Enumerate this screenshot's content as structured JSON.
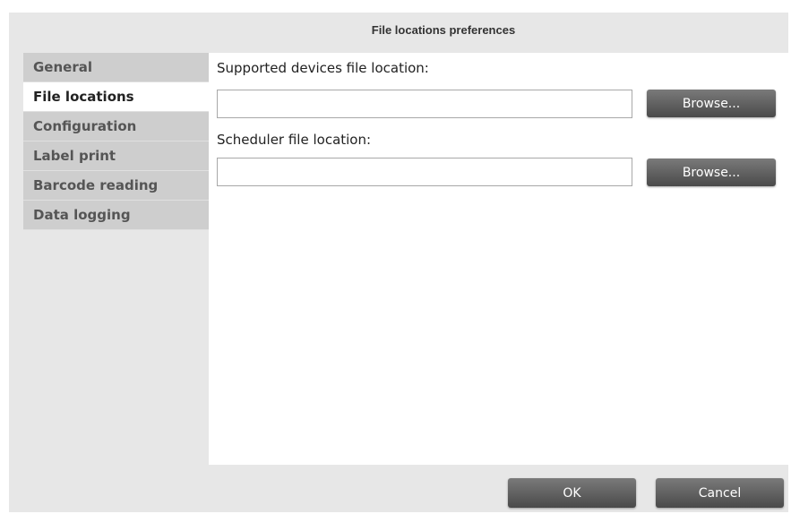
{
  "dialog": {
    "title": "File locations preferences"
  },
  "sidebar": {
    "items": [
      {
        "label": "General",
        "active": false
      },
      {
        "label": "File locations",
        "active": true
      },
      {
        "label": "Configuration",
        "active": false
      },
      {
        "label": "Label print",
        "active": false
      },
      {
        "label": "Barcode reading",
        "active": false
      },
      {
        "label": "Data logging",
        "active": false
      }
    ]
  },
  "content": {
    "supported_devices": {
      "label": "Supported devices file location:",
      "value": "",
      "browse_label": "Browse..."
    },
    "scheduler": {
      "label": "Scheduler file location:",
      "value": "",
      "browse_label": "Browse..."
    }
  },
  "footer": {
    "ok_label": "OK",
    "cancel_label": "Cancel"
  }
}
